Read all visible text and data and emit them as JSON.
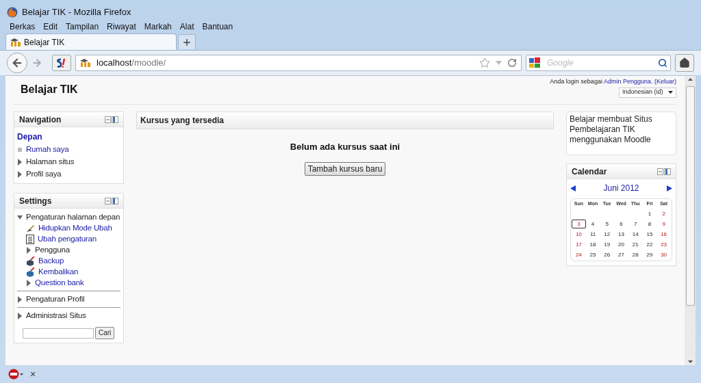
{
  "window": {
    "title": "Belajar TIK - Mozilla Firefox"
  },
  "menu": [
    "Berkas",
    "Edit",
    "Tampilan",
    "Riwayat",
    "Markah",
    "Alat",
    "Bantuan"
  ],
  "tabs": [
    {
      "label": "Belajar TIK",
      "selected": true
    }
  ],
  "address": {
    "host": "localhost",
    "path": "/moodle/"
  },
  "search": {
    "placeholder": "Google"
  },
  "site": {
    "title": "Belajar TIK",
    "login_prefix": "Anda login sebagai",
    "user": "Admin Pengguna.",
    "logout": "(Keluar)",
    "language": "Indonesian (id)"
  },
  "navigation": {
    "title": "Navigation",
    "home": "Depan",
    "items": [
      {
        "label": "Rumah saya",
        "kind": "leaf",
        "link": true
      },
      {
        "label": "Halaman situs",
        "kind": "branch",
        "link": false,
        "expanded": false
      },
      {
        "label": "Profil saya",
        "kind": "branch",
        "link": false,
        "expanded": false
      }
    ]
  },
  "settings": {
    "title": "Settings",
    "items": [
      {
        "label": "Pengaturan halaman depan",
        "kind": "branch",
        "link": false,
        "expanded": true,
        "children": [
          {
            "label": "Hidupkan Mode Ubah",
            "kind": "edit",
            "link": true
          },
          {
            "label": "Ubah pengaturan",
            "kind": "page",
            "link": true
          },
          {
            "label": "Pengguna",
            "kind": "branch",
            "link": false,
            "expanded": false
          },
          {
            "label": "Backup",
            "kind": "backup",
            "link": true
          },
          {
            "label": "Kembalikan",
            "kind": "restore",
            "link": true
          },
          {
            "label": "Question bank",
            "kind": "branch",
            "link": true,
            "expanded": false
          }
        ]
      },
      {
        "label": "Pengaturan Profil",
        "kind": "branch",
        "link": false,
        "expanded": false
      },
      {
        "label": "Administrasi Situs",
        "kind": "branch",
        "link": false,
        "expanded": false
      }
    ],
    "search_button": "Cari"
  },
  "courses": {
    "title": "Kursus yang tersedia",
    "empty": "Belum ada kursus saat ini",
    "add_button": "Tambah kursus baru"
  },
  "about": "Belajar membuat Situs Pembelajaran TIK menggunakan Moodle",
  "calendar": {
    "title": "Calendar",
    "month": "Juni 2012",
    "weekdays": [
      "Sun",
      "Mon",
      "Tue",
      "Wed",
      "Thu",
      "Fri",
      "Sat"
    ],
    "weeks": [
      [
        {
          "d": "1",
          "today": false
        },
        {
          "d": "2",
          "today": false
        }
      ],
      [
        {
          "d": "3",
          "today": true
        },
        {
          "d": "4",
          "today": false
        },
        {
          "d": "5",
          "today": false
        },
        {
          "d": "6",
          "today": false
        },
        {
          "d": "7",
          "today": false
        },
        {
          "d": "8",
          "today": false
        },
        {
          "d": "9",
          "today": false
        }
      ],
      [
        {
          "d": "10",
          "today": false
        },
        {
          "d": "11",
          "today": false
        },
        {
          "d": "12",
          "today": false
        },
        {
          "d": "13",
          "today": false
        },
        {
          "d": "14",
          "today": false
        },
        {
          "d": "15",
          "today": false
        },
        {
          "d": "16",
          "today": false
        }
      ],
      [
        {
          "d": "17",
          "today": false
        },
        {
          "d": "18",
          "today": false
        },
        {
          "d": "19",
          "today": false
        },
        {
          "d": "20",
          "today": false
        },
        {
          "d": "21",
          "today": false
        },
        {
          "d": "22",
          "today": false
        },
        {
          "d": "23",
          "today": false
        }
      ],
      [
        {
          "d": "24",
          "today": false
        },
        {
          "d": "25",
          "today": false
        },
        {
          "d": "26",
          "today": false
        },
        {
          "d": "27",
          "today": false
        },
        {
          "d": "28",
          "today": false
        },
        {
          "d": "29",
          "today": false
        },
        {
          "d": "30",
          "today": false
        }
      ]
    ]
  },
  "status_bar": {
    "close": "×"
  }
}
